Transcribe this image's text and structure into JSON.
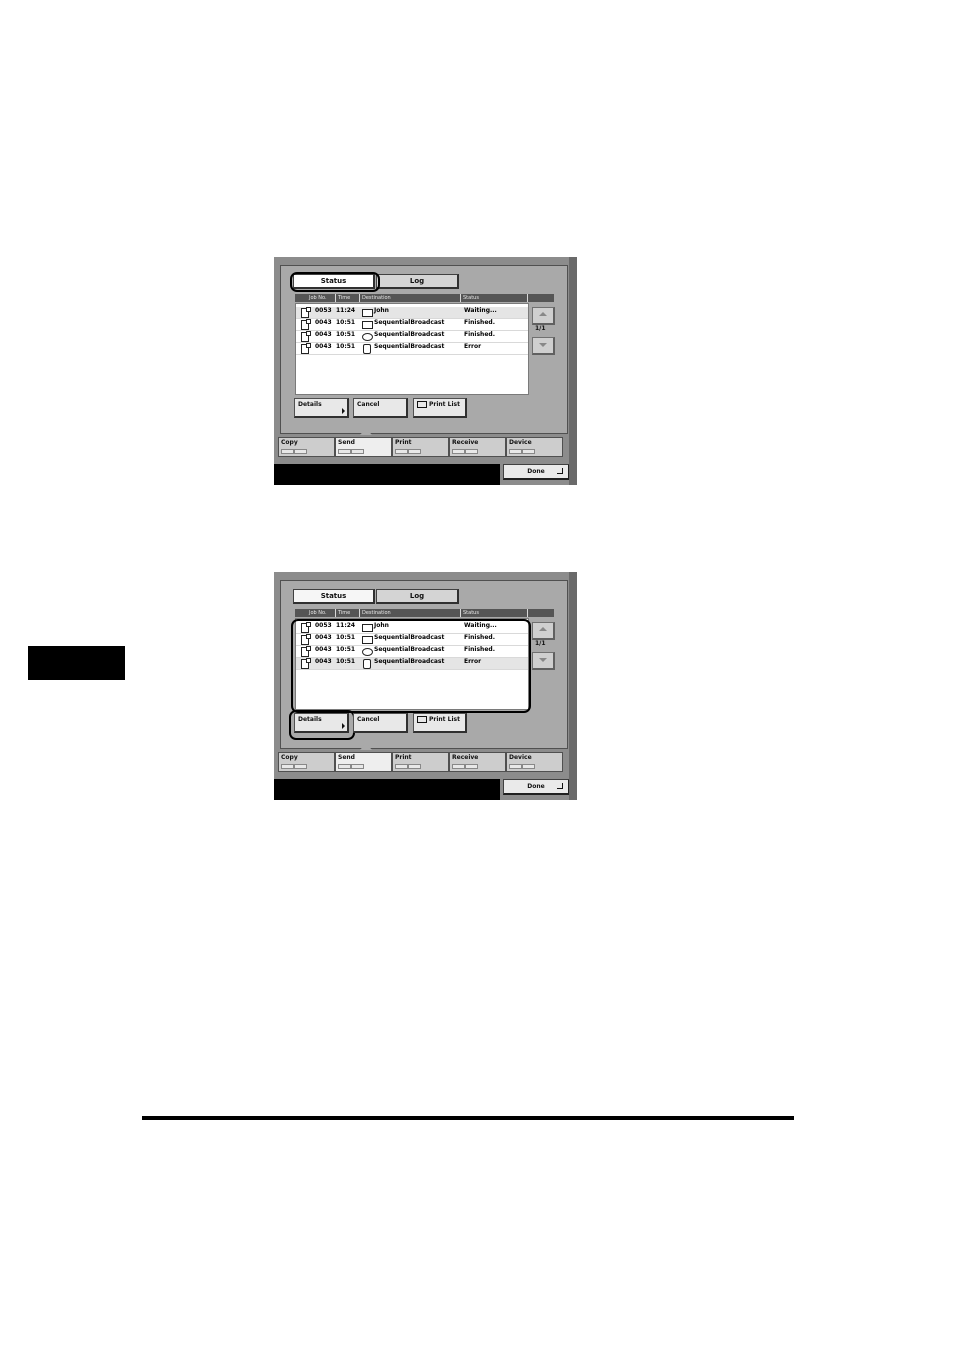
{
  "jobs_panel": {
    "tabs": {
      "status": "Status",
      "log": "Log"
    },
    "columns": {
      "job_no": "Job No.",
      "time": "Time",
      "destination": "Destination",
      "status": "Status"
    },
    "rows": [
      {
        "job_no": "0053",
        "time": "11:24",
        "dest_icon": "mailbox-icon",
        "destination": "John",
        "status": "Waiting..."
      },
      {
        "job_no": "0043",
        "time": "10:51",
        "dest_icon": "mailbox-icon",
        "destination": "SequentialBroadcast",
        "status": "Finished."
      },
      {
        "job_no": "0043",
        "time": "10:51",
        "dest_icon": "globe-icon",
        "destination": "SequentialBroadcast",
        "status": "Finished."
      },
      {
        "job_no": "0043",
        "time": "10:51",
        "dest_icon": "database-icon",
        "destination": "SequentialBroadcast",
        "status": "Error"
      }
    ],
    "page": "1/1",
    "buttons": {
      "details": "Details",
      "cancel": "Cancel",
      "print_list": "Print List"
    },
    "function_keys": [
      "Copy",
      "Send",
      "Print",
      "Receive",
      "Device"
    ],
    "selected_function": "Send",
    "done": "Done"
  }
}
